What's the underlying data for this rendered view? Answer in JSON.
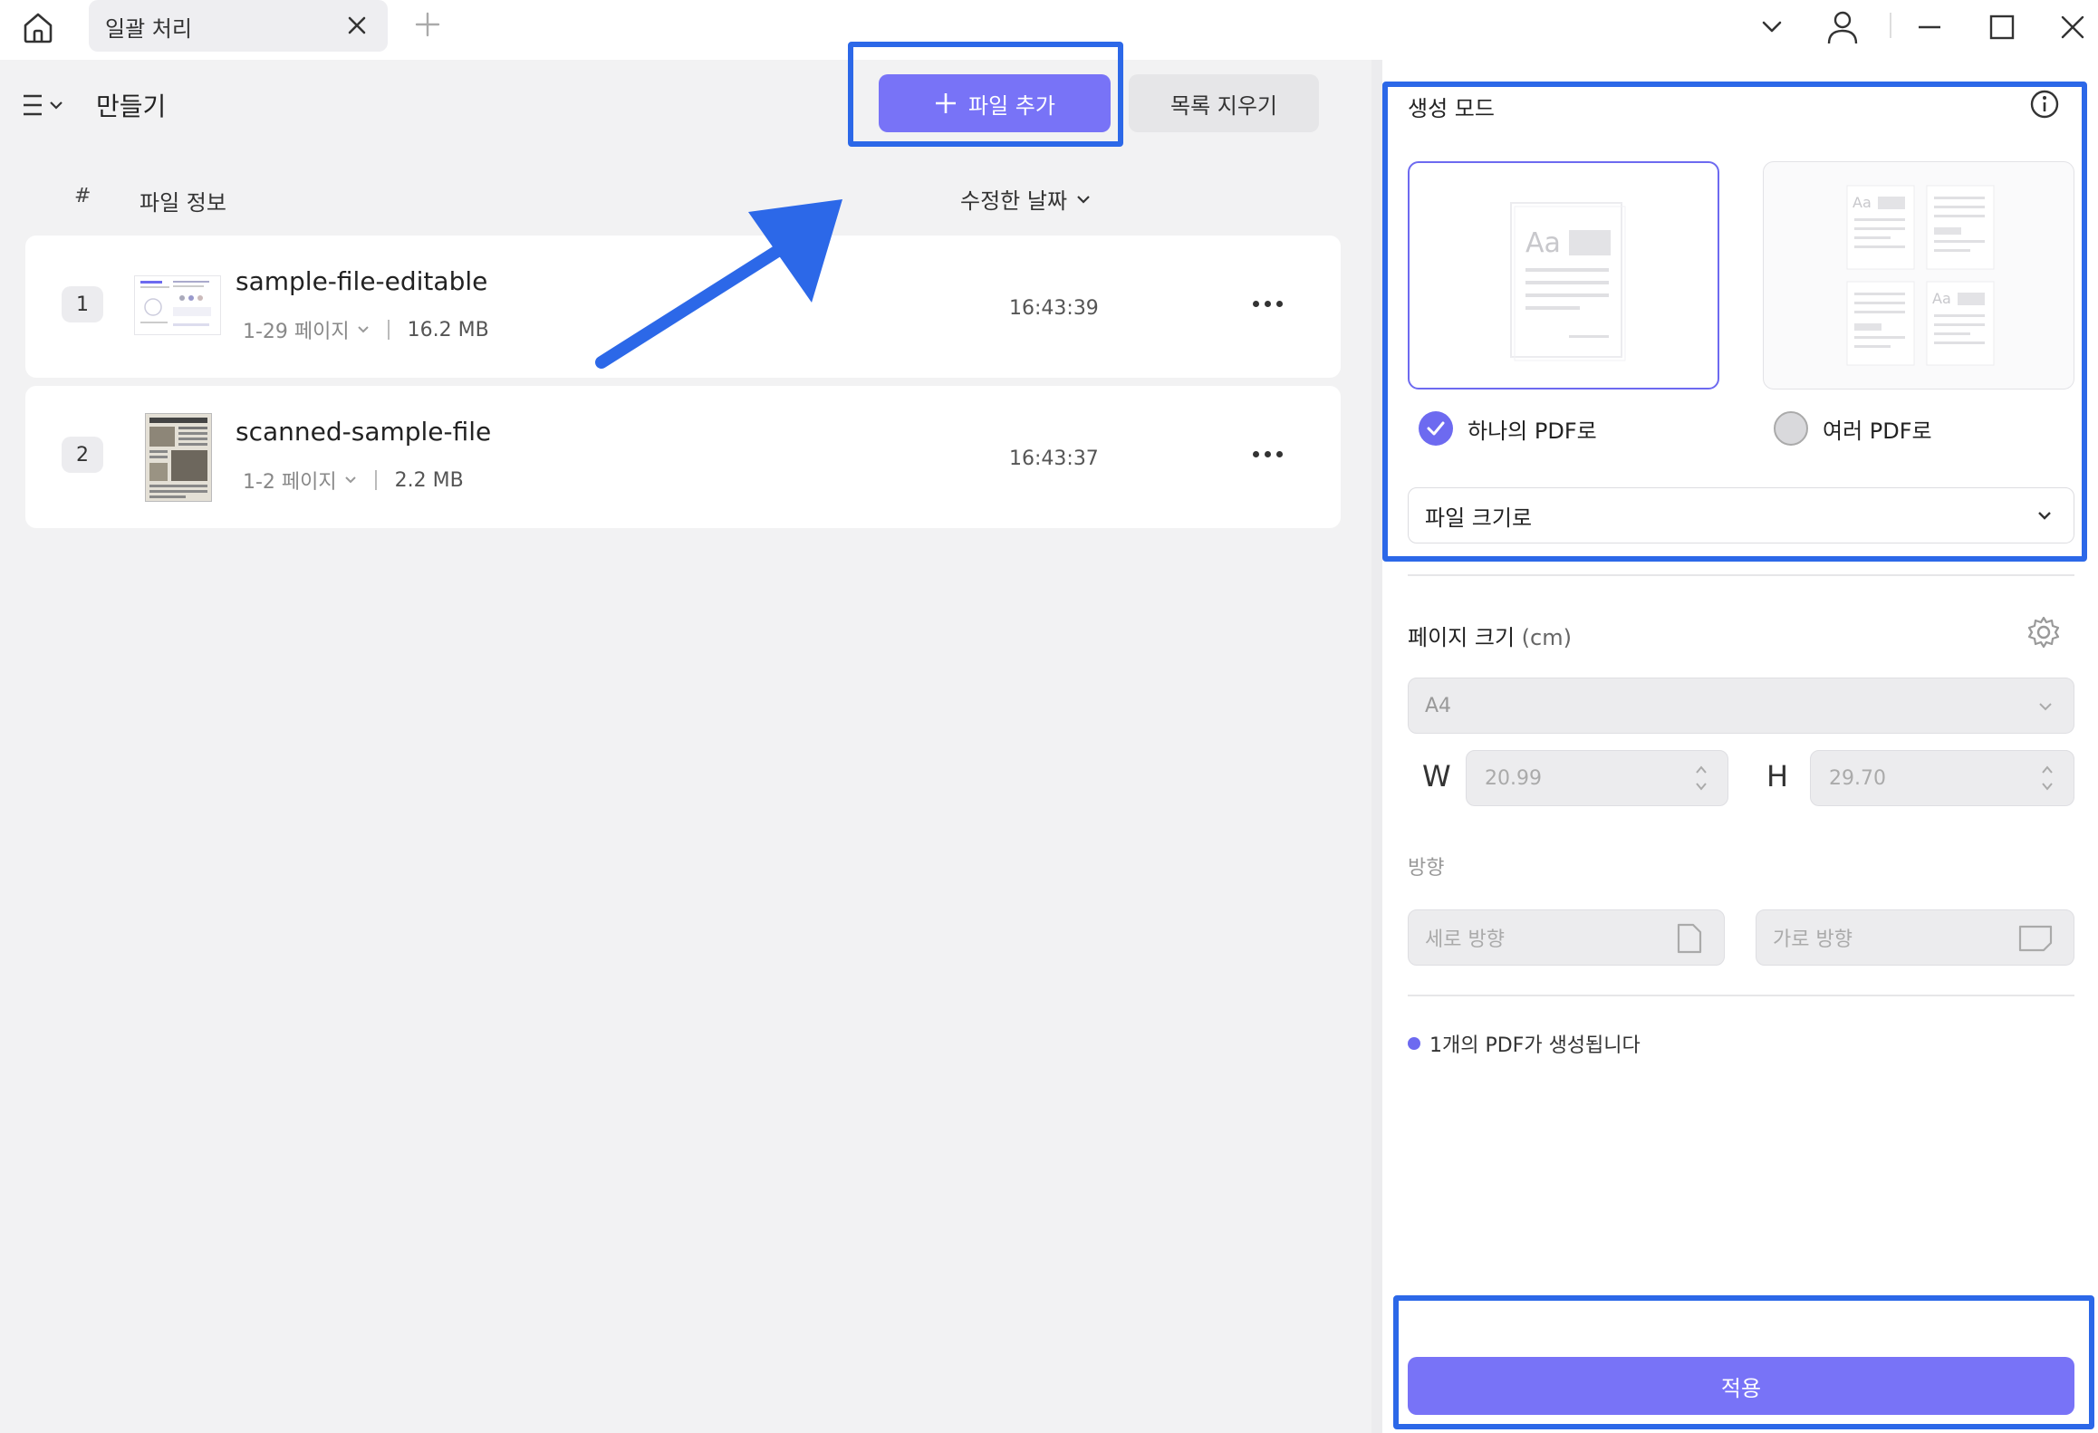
{
  "titlebar": {
    "tab_label": "일괄 처리"
  },
  "left_panel": {
    "title": "만들기",
    "add_file_label": "파일 추가",
    "clear_list_label": "목록 지우기",
    "columns": {
      "index": "#",
      "file_info": "파일 정보",
      "modified_date": "수정한 날짜"
    },
    "files": [
      {
        "index": "1",
        "name": "sample-file-editable",
        "pages": "1-29 페이지",
        "size": "16.2 MB",
        "time": "16:43:39"
      },
      {
        "index": "2",
        "name": "scanned-sample-file",
        "pages": "1-2 페이지",
        "size": "2.2 MB",
        "time": "16:43:37"
      }
    ]
  },
  "right_panel": {
    "mode_title": "생성 모드",
    "option_single": "하나의 PDF로",
    "option_multi": "여러 PDF로",
    "single_selected": true,
    "card_sample_text": "Aa",
    "split_select": "파일 크기로",
    "page_size_title": "페이지 크기",
    "page_size_unit": "(cm)",
    "paper_select": "A4",
    "width_label": "W",
    "width_value": "20.99",
    "height_label": "H",
    "height_value": "29.70",
    "orientation_label": "방향",
    "portrait_label": "세로 방향",
    "landscape_label": "가로 방향",
    "result_note": "1개의 PDF가 생성됩니다",
    "apply_label": "적용"
  },
  "colors": {
    "accent": "#7873f7",
    "highlight_border": "#2c68e8",
    "panel_bg": "#f2f2f3"
  }
}
